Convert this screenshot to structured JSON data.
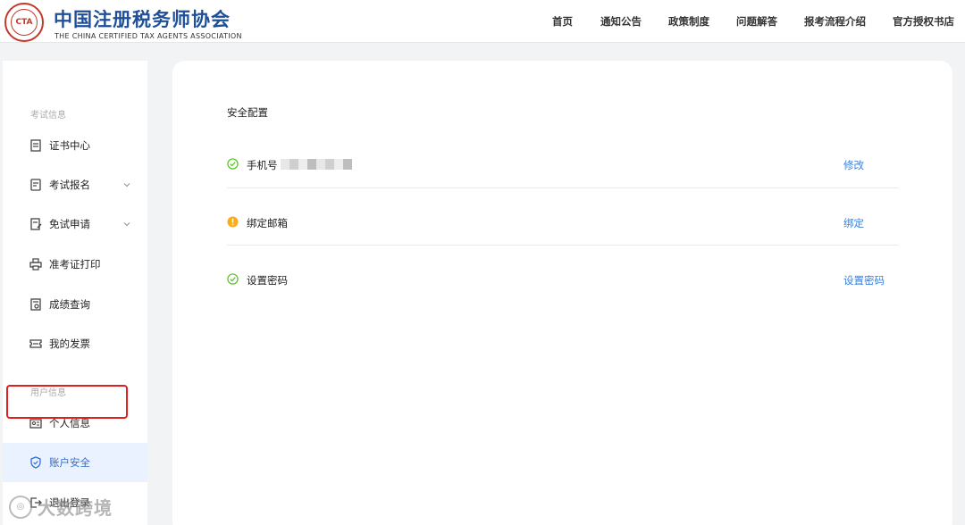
{
  "header": {
    "logo_text": "CTA",
    "brand_cn": "中国注册税务师协会",
    "brand_en": "THE CHINA CERTIFIED TAX AGENTS ASSOCIATION",
    "nav": [
      "首页",
      "通知公告",
      "政策制度",
      "问题解答",
      "报考流程介绍",
      "官方授权书店"
    ]
  },
  "sidebar": {
    "group_exam": "考试信息",
    "group_user": "用户信息",
    "items": [
      {
        "label": "证书中心",
        "icon": "certificate-icon"
      },
      {
        "label": "考试报名",
        "icon": "registration-icon",
        "expandable": true
      },
      {
        "label": "免试申请",
        "icon": "exemption-icon",
        "expandable": true
      },
      {
        "label": "准考证打印",
        "icon": "printer-icon"
      },
      {
        "label": "成绩查询",
        "icon": "score-icon"
      },
      {
        "label": "我的发票",
        "icon": "invoice-icon"
      },
      {
        "label": "个人信息",
        "icon": "id-card-icon"
      },
      {
        "label": "账户安全",
        "icon": "shield-icon",
        "active": true
      },
      {
        "label": "退出登录",
        "icon": "logout-icon"
      }
    ]
  },
  "main": {
    "section_title": "安全配置",
    "rows": [
      {
        "label": "手机号",
        "status": "ok",
        "action": "修改",
        "masked": true
      },
      {
        "label": "绑定邮箱",
        "status": "warning",
        "action": "绑定"
      },
      {
        "label": "设置密码",
        "status": "ok",
        "action": "设置密码"
      }
    ]
  },
  "watermark": {
    "text": "大数跨境"
  },
  "colors": {
    "brand_blue": "#1d4f9a",
    "link_blue": "#3b7fd9",
    "ok_green": "#52c41a",
    "warning_orange": "#faad14",
    "highlight_red": "#e02020"
  }
}
